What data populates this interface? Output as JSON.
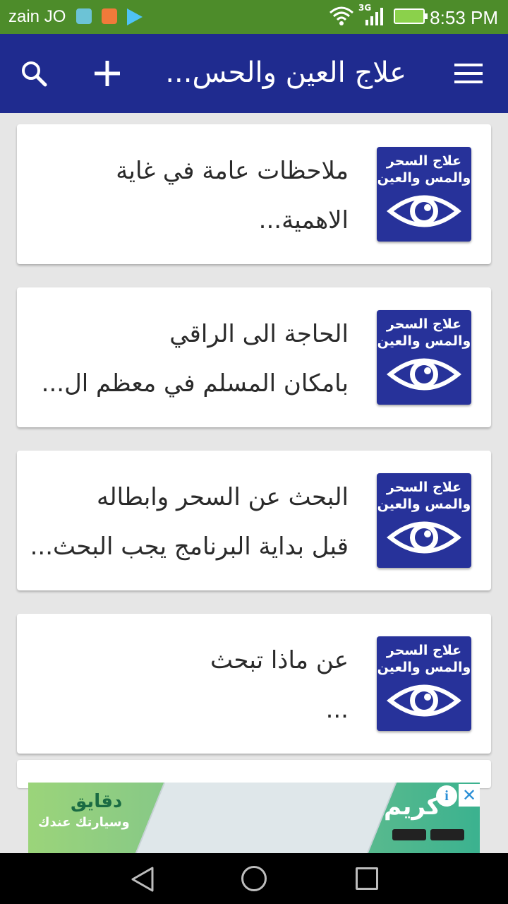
{
  "status_bar": {
    "carrier": "zain JO",
    "network": "3G",
    "time": "8:53 PM"
  },
  "toolbar": {
    "title": "علاج العين والحس...",
    "icons": [
      "search-icon",
      "add-icon",
      "menu-icon"
    ]
  },
  "thumbnail": {
    "line1": "علاج السحر",
    "line2": "والمس والعين",
    "icon": "eye-icon"
  },
  "items": [
    {
      "title": "ملاحظات عامة في غاية",
      "subtitle": "الاهمية..."
    },
    {
      "title": "الحاجة الى الراقي",
      "subtitle": "بامكان المسلم في معظم ال..."
    },
    {
      "title": "البحث عن السحر وابطاله",
      "subtitle": "قبل بداية البرنامج يجب البحث..."
    },
    {
      "title": "عن ماذا تبحث",
      "subtitle": "..."
    }
  ],
  "ad": {
    "headline": "دقايق",
    "tagline": "وسيارتك عندك",
    "brand": "كريم",
    "info_label": "i",
    "close_label": "✕"
  },
  "colors": {
    "status_bar": "#4d8c2a",
    "toolbar": "#1f2b8f",
    "thumbnail": "#27329a",
    "background": "#e6e6e6"
  }
}
